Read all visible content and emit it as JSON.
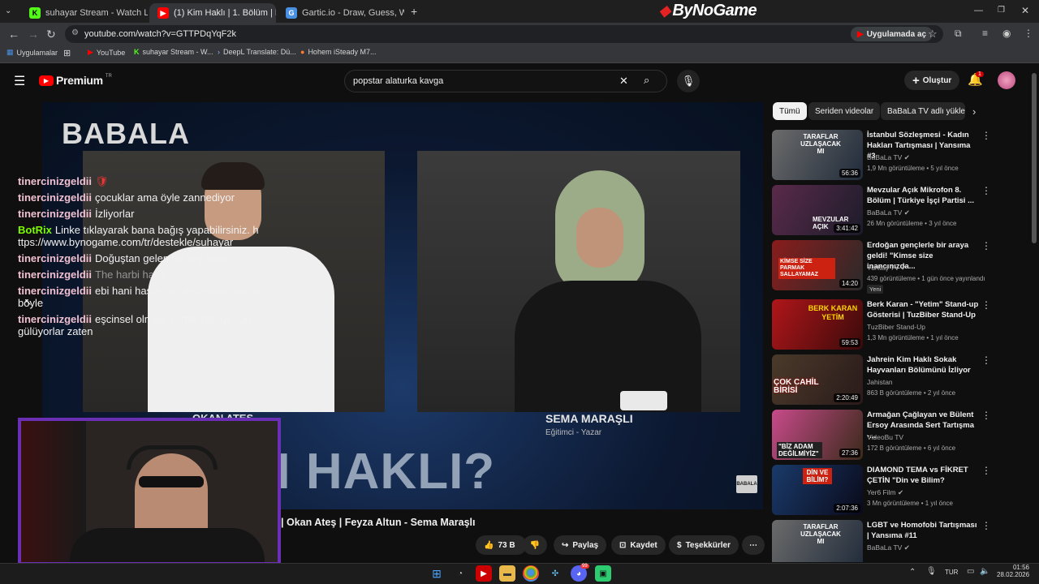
{
  "browser": {
    "tabs": [
      {
        "title": "suhayar Stream - Watch Live o",
        "icon": "kick-icon"
      },
      {
        "title": "(1) Kim Haklı | 1. Bölüm | Femin",
        "icon": "youtube-icon"
      },
      {
        "title": "Gartic.io - Draw, Guess, WIN",
        "icon": "gartic-icon"
      }
    ],
    "overlay_brand": "ByNoGame",
    "url": "youtube.com/watch?v=GTTPDqYqF2k",
    "open_in_app": "Uygulamada aç",
    "bookmarks": [
      "Uygulamalar",
      "YouTube",
      "suhayar Stream - W...",
      "DeepL Translate: Dü...",
      "Hohem iSteady M7..."
    ]
  },
  "youtube": {
    "logo_text": "Premium",
    "logo_badge": "TR",
    "search_query": "popstar alaturka kavga",
    "create_label": "Oluştur",
    "notif_count": "1",
    "chips": [
      "Tümü",
      "Seriden videolar",
      "BaBaLa TV adlı yükle"
    ]
  },
  "video": {
    "brand": "BABALA",
    "big_title": "KİM HAKLI?",
    "left_nameplate": "OKAN ATEŞ",
    "right_name": "SEMA MARAŞLI",
    "right_role": "Eğitimci - Yazar",
    "corner_logo": "BABALA",
    "title_visible": "| Okan Ateş | Feyza Altun - Sema Maraşlı"
  },
  "chat": [
    {
      "user": "tinercinizgeldii",
      "text": "🛡",
      "bot": false
    },
    {
      "user": "tinercinizgeldii",
      "text": "çocuklar ama öyle zannediyor",
      "bot": false
    },
    {
      "user": "tinercinizgeldii",
      "text": "İzliyorlar",
      "bot": false
    },
    {
      "user": "BotRix",
      "text": "Linke tıklayarak bana bağış yapabilirsiniz. https://www.bynogame.com/tr/destekle/suhayar",
      "bot": true
    },
    {
      "user": "tinercinizgeldii",
      "text": "Doğuştan gelen bir şey zaten",
      "bot": false
    },
    {
      "user": "tinercinizgeldii",
      "text": "The harbi hade",
      "bot": false
    },
    {
      "user": "tinercinizgeldii",
      "text": "ebi hani hasta için değiştiremiyon ki böyle",
      "bot": false
    },
    {
      "user": "tinercinizgeldii",
      "text": "eşcinsel olması komik olduğu için gülüyorlar zaten",
      "bot": false
    }
  ],
  "actions": {
    "likes": "73 B",
    "share": "Paylaş",
    "save": "Kaydet",
    "thanks": "Teşekkürler"
  },
  "recommendations": [
    {
      "title": "İstanbul Sözleşmesi - Kadın Hakları Tartışması | Yansıma #3",
      "channel": "BaBaLa TV",
      "verified": true,
      "views": "1,9 Mn görüntüleme",
      "age": "5 yıl önce",
      "duration": "56:36",
      "thumb_text": "TARAFLAR UZLAŞACAK MI"
    },
    {
      "title": "Mevzular Açık Mikrofon 8. Bölüm | Türkiye İşçi Partisi ...",
      "channel": "BaBaLa TV",
      "verified": true,
      "views": "26 Mn görüntüleme",
      "age": "3 yıl önce",
      "duration": "3:41:42",
      "thumb_text": "MEVZULAR AÇIK"
    },
    {
      "title": "Erdoğan gençlerle bir araya geldi! \"Kimse size inancınızda...",
      "channel": "Yurttaş TV",
      "verified": true,
      "views": "439 görüntüleme",
      "age": "1 gün önce yayınlandı",
      "badge": "Yeni",
      "duration": "14:20",
      "thumb_text": "KİMSE SİZE PARMAK SALLAYAMAZ"
    },
    {
      "title": "Berk Karan - \"Yetim\" Stand-up Gösterisi | TuzBiber Stand-Up",
      "channel": "TuzBiber Stand-Up",
      "verified": false,
      "views": "1,3 Mn görüntüleme",
      "age": "1 yıl önce",
      "duration": "59:53",
      "thumb_text": "BERK KARAN YETİM"
    },
    {
      "title": "Jahrein Kim Haklı Sokak Hayvanları Bölümünü İzliyor",
      "channel": "Jahistan",
      "verified": false,
      "views": "863 B görüntüleme",
      "age": "2 yıl önce",
      "duration": "2:20:49",
      "thumb_text": "ÇOK CAHİL BİRİSİ"
    },
    {
      "title": "Armağan Çağlayan ve Bülent Ersoy Arasında Sert Tartışma -...",
      "channel": "VideoBu TV",
      "verified": false,
      "views": "172 B görüntüleme",
      "age": "6 yıl önce",
      "duration": "27:36",
      "thumb_text": "\"BİZ ADAM DEĞİLMİYİZ\""
    },
    {
      "title": "DIAMOND TEMA vs FİKRET ÇETİN \"Din ve Bilim?",
      "channel": "Yer6 Film",
      "verified": true,
      "views": "3 Mn görüntüleme",
      "age": "1 yıl önce",
      "duration": "2:07:36",
      "thumb_text": "DİN VE BİLİM?"
    },
    {
      "title": "LGBT ve Homofobi Tartışması | Yansıma #11",
      "channel": "BaBaLa TV",
      "verified": true,
      "views": "",
      "age": "",
      "duration": "",
      "thumb_text": "TARAFLAR UZLAŞACAK MI"
    }
  ],
  "taskbar": {
    "lang": "TUR",
    "time": "01:56",
    "date": "28.02.2026",
    "discord_badge": "99"
  },
  "colors": {
    "youtube_red": "#ff0000",
    "chat_name": "#f0c0d0",
    "bot_name": "#7cfc00",
    "webcam_frame": "#6a2fb5"
  }
}
